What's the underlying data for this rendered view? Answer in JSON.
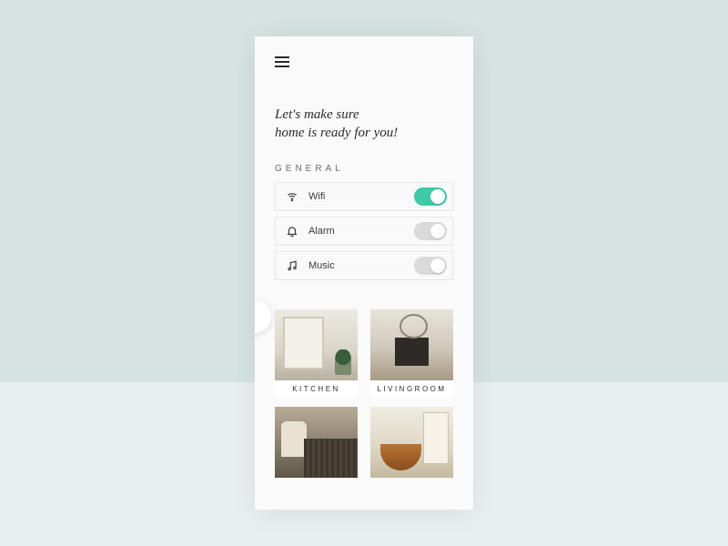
{
  "greeting": {
    "line1": "Let's make sure",
    "line2": "home is ready for you!"
  },
  "section_label": "GENERAL",
  "controls": [
    {
      "icon": "wifi-icon",
      "label": "Wifi",
      "on": true
    },
    {
      "icon": "bell-icon",
      "label": "Alarm",
      "on": false
    },
    {
      "icon": "music-icon",
      "label": "Music",
      "on": false
    }
  ],
  "rooms": [
    {
      "key": "kitchen",
      "label": "KITCHEN"
    },
    {
      "key": "living",
      "label": "LIVINGROOM"
    },
    {
      "key": "bedroom",
      "label": ""
    },
    {
      "key": "bath",
      "label": ""
    }
  ],
  "colors": {
    "toggle_on": "#3ec9a7",
    "toggle_off": "#dadada",
    "page_bg": "#d6e3e1"
  }
}
